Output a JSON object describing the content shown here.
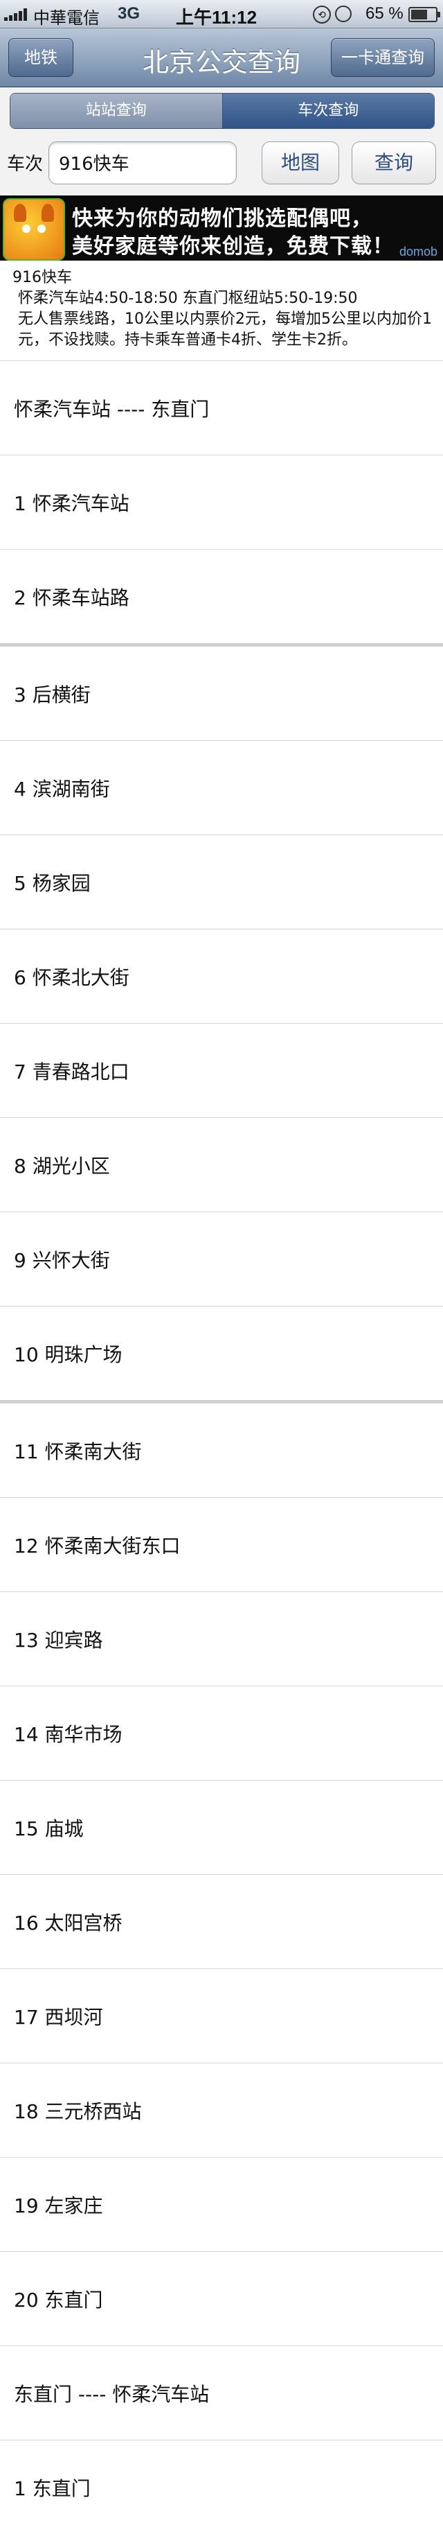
{
  "status_bar": {
    "carrier": "中華電信",
    "network": "3G",
    "time": "上午11:12",
    "battery": "65 %"
  },
  "nav": {
    "left_button": "地铁",
    "title": "北京公交查询",
    "right_button": "一卡通查询"
  },
  "segments": [
    "站站查询",
    "车次查询"
  ],
  "search": {
    "label": "车次",
    "value": "916快车",
    "map_button": "地图",
    "query_button": "查询"
  },
  "ad": {
    "line1": "快来为你的动物们挑选配偶吧，",
    "line2": "美好家庭等你来创造，免费下载！",
    "brand": "domob"
  },
  "route_info": {
    "name": "916快车",
    "hours": "怀柔汽车站4:50-18:50 东直门枢纽站5:50-19:50",
    "fare": "无人售票线路，10公里以内票价2元，每增加5公里以内加价1元，不设找赎。持卡乘车普通卡4折、学生卡2折。"
  },
  "rows": [
    {
      "label": "怀柔汽车站 ---- 东直门"
    },
    {
      "label": "1 怀柔汽车站"
    },
    {
      "label": "2 怀柔车站路"
    },
    {
      "label": "3 后横街"
    },
    {
      "label": "4 滨湖南街"
    },
    {
      "label": "5 杨家园"
    },
    {
      "label": "6 怀柔北大街"
    },
    {
      "label": "7 青春路北口"
    },
    {
      "label": "8 湖光小区"
    },
    {
      "label": "9 兴怀大街"
    },
    {
      "label": "10 明珠广场"
    },
    {
      "label": "11 怀柔南大街"
    },
    {
      "label": "12 怀柔南大街东口"
    },
    {
      "label": "13 迎宾路"
    },
    {
      "label": "14 南华市场"
    },
    {
      "label": "15 庙城"
    },
    {
      "label": "16 太阳宫桥"
    },
    {
      "label": "17 西坝河"
    },
    {
      "label": "18 三元桥西站"
    },
    {
      "label": "19 左家庄"
    },
    {
      "label": "20 东直门"
    },
    {
      "label": "东直门 ---- 怀柔汽车站"
    },
    {
      "label": "1 东直门"
    }
  ]
}
